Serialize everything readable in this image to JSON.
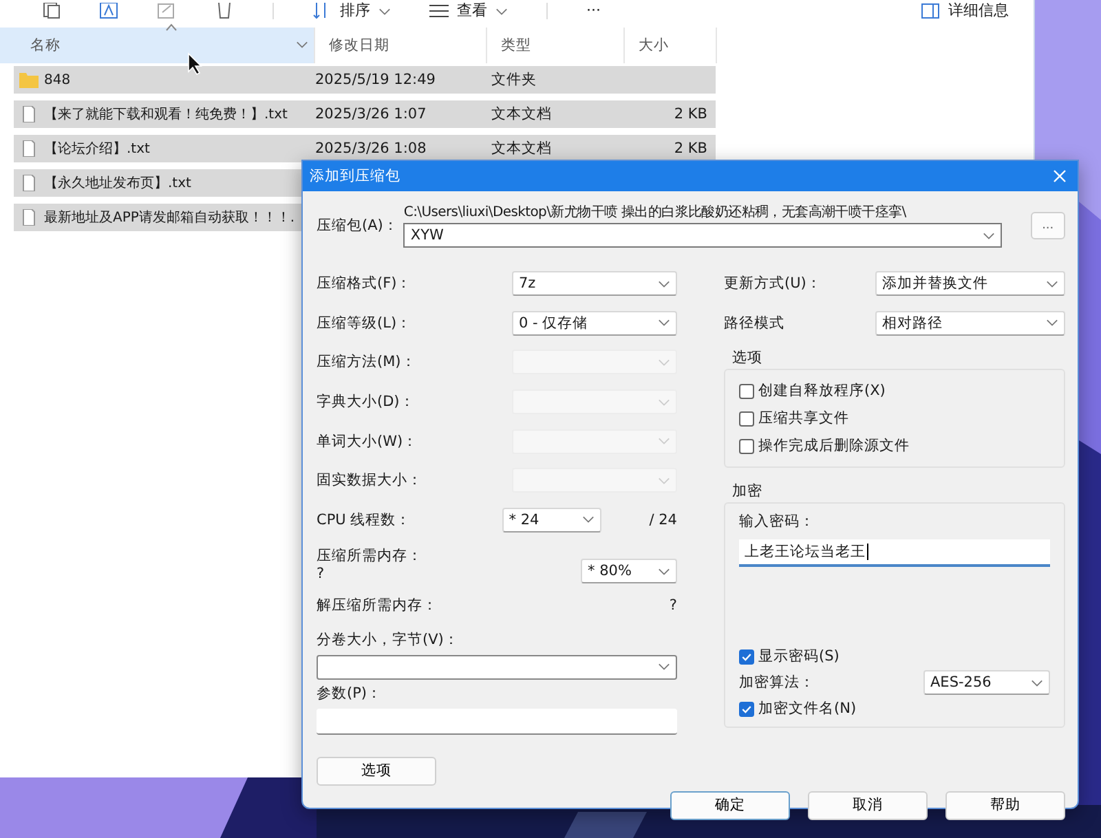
{
  "explorer": {
    "toolbar": [
      {
        "kind": "menu",
        "label": "排序"
      },
      {
        "kind": "menu",
        "label": "查看"
      },
      {
        "kind": "more",
        "label": "···"
      }
    ],
    "details_button": "详细信息",
    "columns": [
      {
        "label": "名称",
        "sorted": true
      },
      {
        "label": "修改日期",
        "sorted": false
      },
      {
        "label": "类型",
        "sorted": false
      },
      {
        "label": "大小",
        "sorted": false
      }
    ],
    "rows": [
      {
        "kind": "folder",
        "name": "848",
        "date": "2025/5/19 12:49",
        "type": "文件夹",
        "selected": true
      },
      {
        "kind": "file",
        "name": "【来了就能下载和观看！纯免费！】.txt",
        "date": "2025/3/26 1:07",
        "type": "文本文档",
        "size": "2 KB",
        "selected": true
      },
      {
        "kind": "file",
        "name": "【论坛介绍】.txt",
        "date": "2025/3/26 1:08",
        "type": "文本文档",
        "size": "2 KB",
        "selected": true
      },
      {
        "kind": "file",
        "name": "【永久地址发布页】.txt",
        "selected": true
      },
      {
        "kind": "file",
        "name": "最新地址及APP请发邮箱自动获取！！！.",
        "selected": true
      }
    ]
  },
  "dialog": {
    "title": "添加到压缩包",
    "archive": {
      "label": "压缩包(A)：",
      "path": "C:\\Users\\liuxi\\Desktop\\新尤物干喷   操出的白浆比酸奶还粘稠，无套高潮干喷干痉挛\\",
      "value": "XYW",
      "browse": "..."
    },
    "left": [
      {
        "kind": "select",
        "label": "压缩格式(F)：",
        "value": "7z",
        "disabled": false
      },
      {
        "kind": "select",
        "label": "压缩等级(L)：",
        "value": "0 - 仅存储",
        "disabled": false
      },
      {
        "kind": "select",
        "label": "压缩方法(M)：",
        "disabled": true
      },
      {
        "kind": "select",
        "label": "字典大小(D)：",
        "disabled": true
      },
      {
        "kind": "select",
        "label": "单词大小(W)：",
        "disabled": true
      },
      {
        "kind": "select",
        "label": "固实数据大小：",
        "disabled": true
      },
      {
        "kind": "threads",
        "label": "CPU 线程数：",
        "value": "* 24",
        "max": "/ 24"
      },
      {
        "kind": "memory",
        "label": "压缩所需内存：",
        "note": "?",
        "value": "* 80%"
      },
      {
        "kind": "info",
        "label": "解压缩所需内存：",
        "value": "?"
      },
      {
        "kind": "combo",
        "label": "分卷大小，字节(V)："
      },
      {
        "kind": "input",
        "label": "参数(P)："
      }
    ],
    "options_button": "选项",
    "update": {
      "label": "更新方式(U)：",
      "value": "添加并替换文件"
    },
    "path_mode": {
      "label": "路径模式",
      "value": "相对路径"
    },
    "options_group": {
      "title": "选项",
      "checkboxes": [
        {
          "label": "创建自释放程序(X)",
          "checked": false
        },
        {
          "label": "压缩共享文件",
          "checked": false
        },
        {
          "label": "操作完成后删除源文件",
          "checked": false
        }
      ]
    },
    "encryption": {
      "title": "加密",
      "password_label": "输入密码：",
      "password": "上老王论坛当老王",
      "show_password": {
        "label": "显示密码(S)",
        "checked": true
      },
      "method_label": "加密算法：",
      "method": "AES-256",
      "encrypt_names": {
        "label": "加密文件名(N)",
        "checked": true
      }
    },
    "buttons": [
      {
        "label": "确定",
        "default": true
      },
      {
        "label": "取消",
        "default": false
      },
      {
        "label": "帮助",
        "default": false
      }
    ]
  }
}
